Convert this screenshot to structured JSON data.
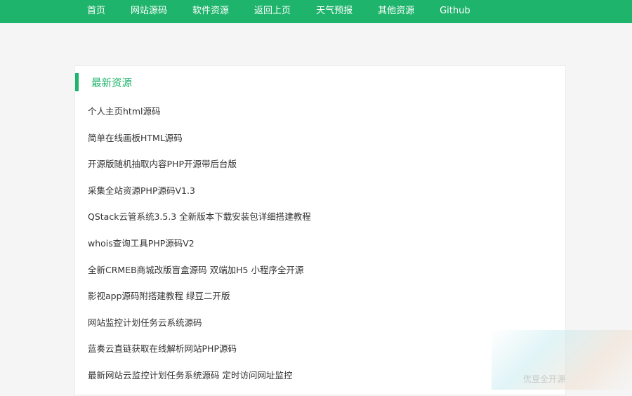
{
  "nav": {
    "items": [
      {
        "label": "首页"
      },
      {
        "label": "网站源码"
      },
      {
        "label": "软件资源"
      },
      {
        "label": "返回上页"
      },
      {
        "label": "天气预报"
      },
      {
        "label": "其他资源"
      },
      {
        "label": "Github"
      }
    ]
  },
  "panel": {
    "title": "最新资源",
    "items": [
      "个人主页html源码",
      "简单在线画板HTML源码",
      "开源版随机抽取内容PHP开源带后台版",
      "采集全站资源PHP源码V1.3",
      "QStack云管系统3.5.3 全新版本下载安装包详细搭建教程",
      "whois查询工具PHP源码V2",
      "全新CRMEB商城改版盲盒源码 双端加H5 小程序全开源",
      "影视app源码附搭建教程 绿豆二开版",
      "网站监控计划任务云系统源码",
      "蓝奏云直链获取在线解析网站PHP源码",
      "最新网站云监控计划任务系统源码 定时访问网址监控"
    ]
  },
  "watermark": {
    "text": "优豆全开源"
  },
  "colors": {
    "accent": "#1fb46b",
    "background": "#f5f5f5",
    "panel": "#ffffff",
    "text": "#333333"
  }
}
